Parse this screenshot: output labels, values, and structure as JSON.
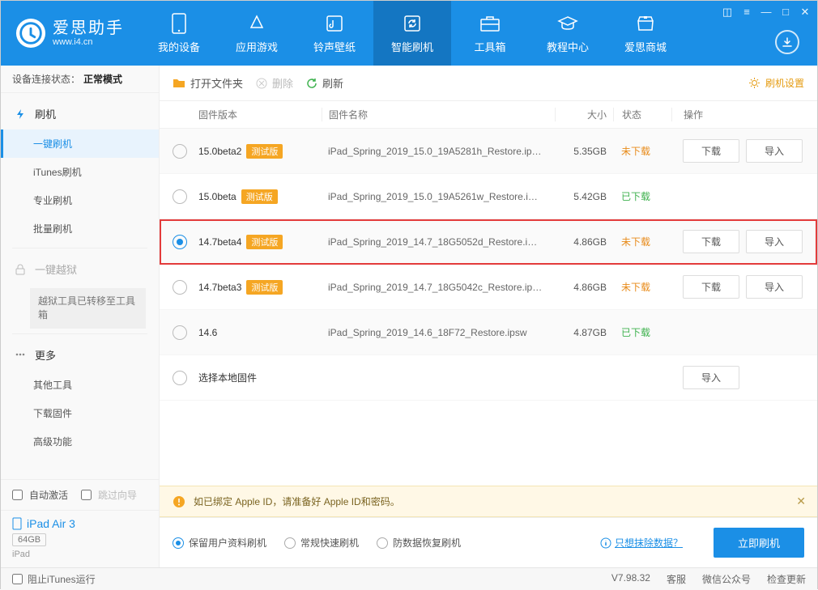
{
  "brand": {
    "cn": "爱思助手",
    "en": "www.i4.cn"
  },
  "nav": [
    {
      "label": "我的设备"
    },
    {
      "label": "应用游戏"
    },
    {
      "label": "铃声壁纸"
    },
    {
      "label": "智能刷机"
    },
    {
      "label": "工具箱"
    },
    {
      "label": "教程中心"
    },
    {
      "label": "爱思商城"
    }
  ],
  "connection": {
    "label": "设备连接状态：",
    "value": "正常模式"
  },
  "sidebar": {
    "flash": {
      "head": "刷机",
      "items": [
        "一键刷机",
        "iTunes刷机",
        "专业刷机",
        "批量刷机"
      ]
    },
    "jailbreak": {
      "head": "一键越狱",
      "note": "越狱工具已转移至工具箱"
    },
    "more": {
      "head": "更多",
      "items": [
        "其他工具",
        "下载固件",
        "高级功能"
      ]
    },
    "auto_activate": "自动激活",
    "skip_guide": "跳过向导",
    "device": {
      "name": "iPad Air 3",
      "storage": "64GB",
      "type": "iPad"
    },
    "block_itunes": "阻止iTunes运行"
  },
  "toolbar": {
    "open": "打开文件夹",
    "delete": "删除",
    "refresh": "刷新",
    "settings": "刷机设置"
  },
  "columns": {
    "version": "固件版本",
    "name": "固件名称",
    "size": "大小",
    "status": "状态",
    "ops": "操作"
  },
  "beta_tag": "测试版",
  "rows": [
    {
      "version": "15.0beta2",
      "beta": true,
      "name": "iPad_Spring_2019_15.0_19A5281h_Restore.ip…",
      "size": "5.35GB",
      "status": "未下载",
      "status_class": "not",
      "selected": false,
      "ops": [
        "下载",
        "导入"
      ],
      "highlight": false
    },
    {
      "version": "15.0beta",
      "beta": true,
      "name": "iPad_Spring_2019_15.0_19A5261w_Restore.i…",
      "size": "5.42GB",
      "status": "已下载",
      "status_class": "done",
      "selected": false,
      "ops": [],
      "highlight": false
    },
    {
      "version": "14.7beta4",
      "beta": true,
      "name": "iPad_Spring_2019_14.7_18G5052d_Restore.i…",
      "size": "4.86GB",
      "status": "未下载",
      "status_class": "not",
      "selected": true,
      "ops": [
        "下载",
        "导入"
      ],
      "highlight": true
    },
    {
      "version": "14.7beta3",
      "beta": true,
      "name": "iPad_Spring_2019_14.7_18G5042c_Restore.ip…",
      "size": "4.86GB",
      "status": "未下载",
      "status_class": "not",
      "selected": false,
      "ops": [
        "下载",
        "导入"
      ],
      "highlight": false
    },
    {
      "version": "14.6",
      "beta": false,
      "name": "iPad_Spring_2019_14.6_18F72_Restore.ipsw",
      "size": "4.87GB",
      "status": "已下载",
      "status_class": "done",
      "selected": false,
      "ops": [],
      "highlight": false
    },
    {
      "version": "选择本地固件",
      "beta": false,
      "name": "",
      "size": "",
      "status": "",
      "status_class": "",
      "selected": false,
      "ops": [
        "导入"
      ],
      "highlight": false
    }
  ],
  "warning": "如已绑定 Apple ID，请准备好 Apple ID和密码。",
  "flash_modes": [
    "保留用户资料刷机",
    "常规快速刷机",
    "防数据恢复刷机"
  ],
  "erase_link": "只想抹除数据？",
  "flash_now": "立即刷机",
  "statusbar": {
    "version": "V7.98.32",
    "items": [
      "客服",
      "微信公众号",
      "检查更新"
    ]
  }
}
